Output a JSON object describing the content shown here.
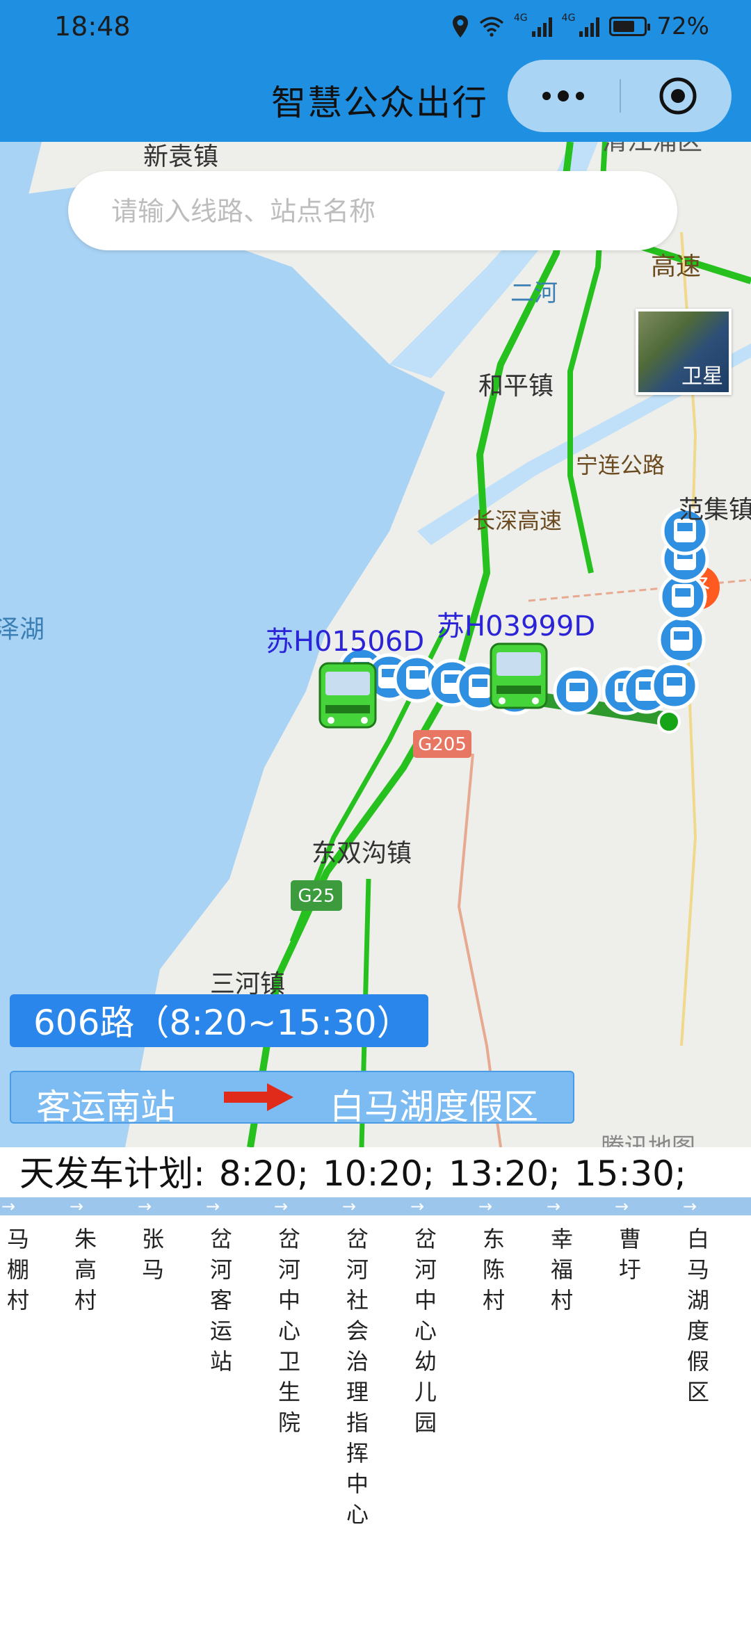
{
  "status_bar": {
    "time": "18:48",
    "battery": "72%",
    "battery_level": 0.72,
    "network_1": "4G",
    "network_2": "4G"
  },
  "header": {
    "title": "智慧公众出行"
  },
  "search": {
    "placeholder": "请输入线路、站点名称"
  },
  "map": {
    "labels": {
      "town_xinyuan": "新袁镇",
      "highway_top": "高速",
      "river": "二河",
      "town_heping": "和平镇",
      "road_ninglian": "宁连公路",
      "road_changshen": "长深高速",
      "town_fanji": "范集镇",
      "lake": "泽湖",
      "town_dongshuanggou": "东双沟镇",
      "town_sanhe": "三河镇",
      "top_right": "清江浦区",
      "g205": "G205",
      "g25": "G25",
      "end_badge": "终"
    },
    "satellite_label": "卫星",
    "buses": [
      "苏H01506D",
      "苏H03999D"
    ],
    "attribution": "腾讯地图"
  },
  "route": {
    "name": "606路（8:20~15:30）",
    "from": "客运南站",
    "to": "白马湖度假区"
  },
  "schedule": {
    "label": "天发车计划:",
    "times": [
      "8:20;",
      "10:20;",
      "13:20;",
      "15:30;"
    ]
  },
  "stops": [
    "马棚村",
    "朱高村",
    "张马",
    "岔河客运站",
    "岔河中心卫生院",
    "岔河社会治理指挥中心",
    "岔河中心幼儿园",
    "东陈村",
    "幸福村",
    "曹圩",
    "白马湖度假区"
  ]
}
